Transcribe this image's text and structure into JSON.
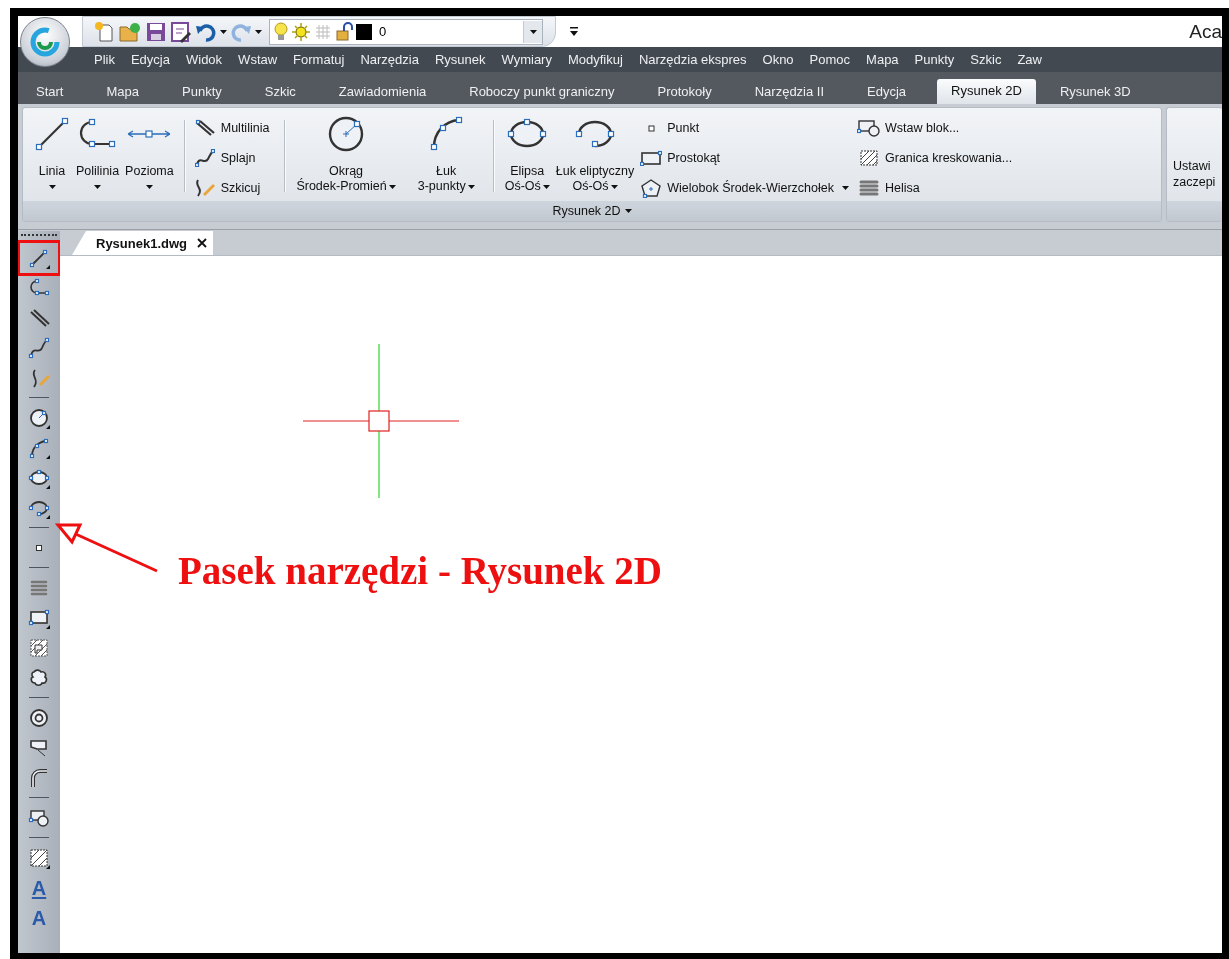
{
  "window": {
    "title": "Aca"
  },
  "quick_access": {
    "layer_value": "0"
  },
  "menu": [
    "Plik",
    "Edycja",
    "Widok",
    "Wstaw",
    "Formatuj",
    "Narzędzia",
    "Rysunek",
    "Wymiary",
    "Modyfikuj",
    "Narzędzia ekspres",
    "Okno",
    "Pomoc",
    "Mapa",
    "Punkty",
    "Szkic",
    "Zaw"
  ],
  "ribbon_tabs": [
    {
      "label": "Start",
      "selected": false
    },
    {
      "label": "Mapa",
      "selected": false
    },
    {
      "label": "Punkty",
      "selected": false
    },
    {
      "label": "Szkic",
      "selected": false
    },
    {
      "label": "Zawiadomienia",
      "selected": false
    },
    {
      "label": "Roboczy punkt graniczny",
      "selected": false
    },
    {
      "label": "Protokoły",
      "selected": false
    },
    {
      "label": "Narzędzia II",
      "selected": false
    },
    {
      "label": "Edycja",
      "selected": false
    },
    {
      "label": "Rysunek 2D",
      "selected": true
    },
    {
      "label": "Rysunek 3D",
      "selected": false
    }
  ],
  "ribbon": {
    "panel_title": "Rysunek 2D",
    "panel_menu": true,
    "columns": [
      {
        "kind": "large",
        "lines": [
          "Linia"
        ],
        "dropdown": true
      },
      {
        "kind": "large",
        "lines": [
          "Polilinia"
        ],
        "dropdown": true
      },
      {
        "kind": "large",
        "lines": [
          "Pozioma"
        ],
        "dropdown": true
      },
      {
        "kind": "separator"
      },
      {
        "kind": "stack",
        "items": [
          {
            "label": "Multilinia",
            "dropdown": false
          },
          {
            "label": "Splajn",
            "dropdown": false
          },
          {
            "label": "Szkicuj",
            "dropdown": false
          }
        ]
      },
      {
        "kind": "separator"
      },
      {
        "kind": "large",
        "lines": [
          "Okrąg",
          "Środek-Promień"
        ],
        "dropdown": true
      },
      {
        "kind": "large",
        "lines": [
          "Łuk",
          "3-punkty"
        ],
        "dropdown": true
      },
      {
        "kind": "separator"
      },
      {
        "kind": "large",
        "lines": [
          "Elipsa",
          "Oś-Oś"
        ],
        "dropdown": true
      },
      {
        "kind": "large",
        "lines": [
          "Łuk eliptyczny",
          "Oś-Oś"
        ],
        "dropdown": true
      },
      {
        "kind": "stack",
        "items": [
          {
            "label": "Punkt",
            "dropdown": false
          },
          {
            "label": "Prostokąt",
            "dropdown": false
          },
          {
            "label": "Wielobok Środek-Wierzchołek",
            "dropdown": true
          }
        ]
      },
      {
        "kind": "stack",
        "items": [
          {
            "label": "Wstaw blok...",
            "dropdown": false
          },
          {
            "label": "Granica kreskowania...",
            "dropdown": false
          },
          {
            "label": "Helisa",
            "dropdown": false
          }
        ]
      }
    ],
    "next_panel_lines": [
      "Ustawi",
      "zaczepi"
    ]
  },
  "document_tabs": [
    {
      "label": "Rysunek1.dwg",
      "selected": true,
      "closable": true
    }
  ],
  "toolbar": {
    "groups": [
      [
        {
          "highlighted": true
        },
        {
          "highlighted": false
        },
        {
          "highlighted": false
        },
        {
          "highlighted": false
        },
        {
          "highlighted": false
        }
      ],
      [
        {
          "highlighted": false
        },
        {
          "highlighted": false
        },
        {
          "highlighted": false
        },
        {
          "highlighted": false
        }
      ],
      [
        {
          "highlighted": false
        }
      ],
      [
        {
          "highlighted": false
        },
        {
          "highlighted": false
        },
        {
          "highlighted": false
        },
        {
          "highlighted": false
        }
      ],
      [
        {
          "highlighted": false
        },
        {
          "highlighted": false
        },
        {
          "highlighted": false
        }
      ],
      [
        {
          "highlighted": false
        }
      ],
      [
        {
          "highlighted": false
        },
        {
          "highlighted": false,
          "glyph": "A",
          "underline": true
        },
        {
          "highlighted": false,
          "glyph": "A",
          "underline": false
        }
      ]
    ]
  },
  "annotation": {
    "text": "Pasek narzędzi - Rysunek 2D"
  }
}
